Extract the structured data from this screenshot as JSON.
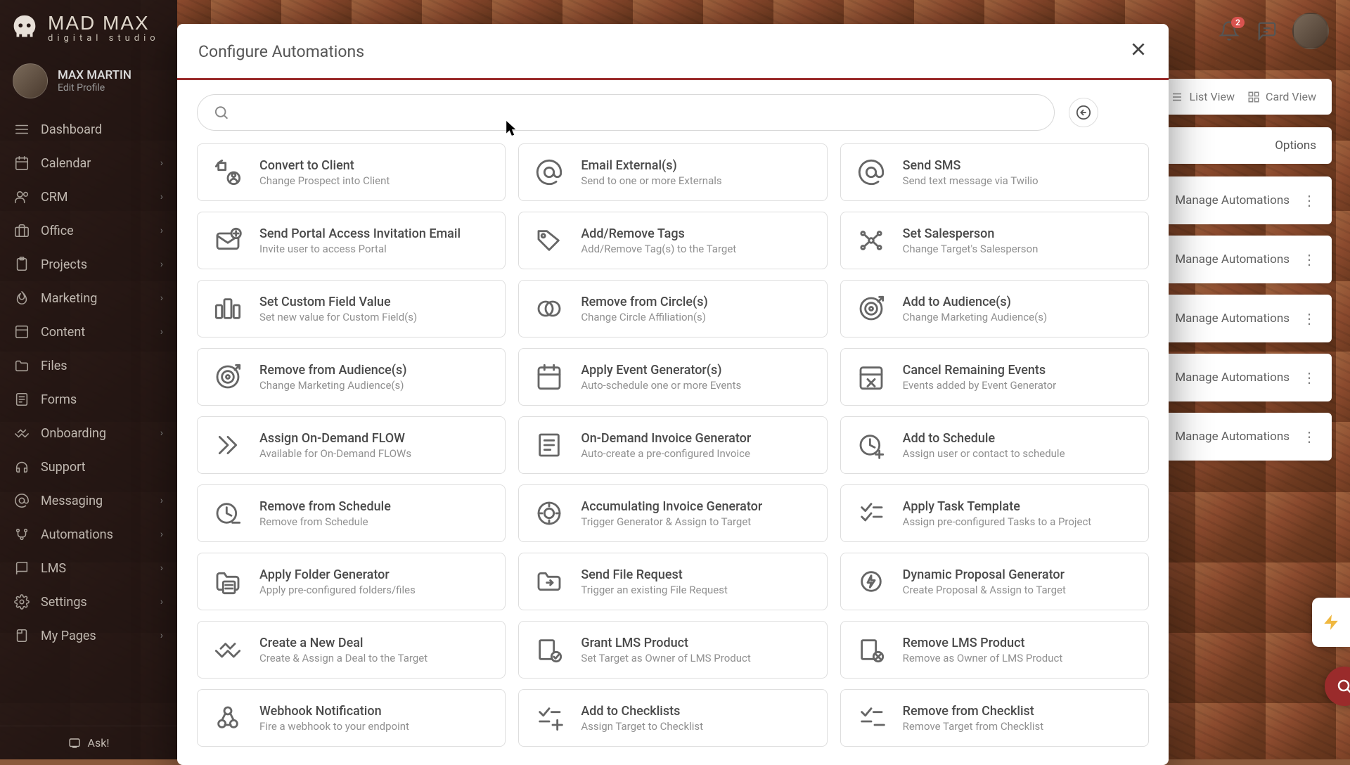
{
  "brand": {
    "name": "MAD MAX",
    "sub": "digital studio"
  },
  "profile": {
    "name": "MAX MARTIN",
    "edit": "Edit Profile"
  },
  "nav": [
    {
      "label": "Dashboard",
      "icon": "menu",
      "chev": false
    },
    {
      "label": "Calendar",
      "icon": "calendar",
      "chev": true
    },
    {
      "label": "CRM",
      "icon": "users",
      "chev": true
    },
    {
      "label": "Office",
      "icon": "briefcase",
      "chev": true
    },
    {
      "label": "Projects",
      "icon": "clipboard",
      "chev": true
    },
    {
      "label": "Marketing",
      "icon": "flame",
      "chev": true
    },
    {
      "label": "Content",
      "icon": "box",
      "chev": true
    },
    {
      "label": "Files",
      "icon": "folder",
      "chev": false
    },
    {
      "label": "Forms",
      "icon": "form",
      "chev": false
    },
    {
      "label": "Onboarding",
      "icon": "handshake",
      "chev": true
    },
    {
      "label": "Support",
      "icon": "headset",
      "chev": false
    },
    {
      "label": "Messaging",
      "icon": "at",
      "chev": true
    },
    {
      "label": "Automations",
      "icon": "branch",
      "chev": true
    },
    {
      "label": "LMS",
      "icon": "book",
      "chev": true
    },
    {
      "label": "Settings",
      "icon": "gear",
      "chev": true
    },
    {
      "label": "My Pages",
      "icon": "page",
      "chev": true
    }
  ],
  "ask": "Ask!",
  "topbar": {
    "notif_count": "2"
  },
  "panel": {
    "list_view": "List View",
    "card_view": "Card View",
    "options": "Options",
    "manage": "Manage Automations"
  },
  "modal": {
    "title": "Configure Automations",
    "search_placeholder": "",
    "cards": [
      {
        "title": "Convert to Client",
        "desc": "Change Prospect into Client",
        "icon": "convert"
      },
      {
        "title": "Email External(s)",
        "desc": "Send to one or more Externals",
        "icon": "at"
      },
      {
        "title": "Send SMS",
        "desc": "Send text message via Twilio",
        "icon": "at"
      },
      {
        "title": "Send Portal Access Invitation Email",
        "desc": "Invite user to access Portal",
        "icon": "mailplus"
      },
      {
        "title": "Add/Remove Tags",
        "desc": "Add/Remove Tag(s) to the Target",
        "icon": "tag"
      },
      {
        "title": "Set Salesperson",
        "desc": "Change Target's Salesperson",
        "icon": "network"
      },
      {
        "title": "Set Custom Field Value",
        "desc": "Set new value for Custom Field(s)",
        "icon": "slider"
      },
      {
        "title": "Remove from Circle(s)",
        "desc": "Change Circle Affiliation(s)",
        "icon": "circles"
      },
      {
        "title": "Add to Audience(s)",
        "desc": "Change Marketing Audience(s)",
        "icon": "target"
      },
      {
        "title": "Remove from Audience(s)",
        "desc": "Change Marketing Audience(s)",
        "icon": "target"
      },
      {
        "title": "Apply Event Generator(s)",
        "desc": "Auto-schedule one or more Events",
        "icon": "calendar"
      },
      {
        "title": "Cancel Remaining Events",
        "desc": "Events added by Event Generator",
        "icon": "calendarx"
      },
      {
        "title": "Assign On-Demand FLOW",
        "desc": "Available for On-Demand FLOWs",
        "icon": "chevrons"
      },
      {
        "title": "On-Demand Invoice Generator",
        "desc": "Auto-create a pre-configured Invoice",
        "icon": "invoice"
      },
      {
        "title": "Add to Schedule",
        "desc": "Assign user or contact to schedule",
        "icon": "clockplus"
      },
      {
        "title": "Remove from Schedule",
        "desc": "Remove from Schedule",
        "icon": "clockminus"
      },
      {
        "title": "Accumulating Invoice Generator",
        "desc": "Trigger Generator & Assign to Target",
        "icon": "geargen"
      },
      {
        "title": "Apply Task Template",
        "desc": "Assign pre-configured Tasks to a Project",
        "icon": "checklist"
      },
      {
        "title": "Apply Folder Generator",
        "desc": "Apply pre-configured folders/files",
        "icon": "foldergen"
      },
      {
        "title": "Send File Request",
        "desc": "Trigger an existing File Request",
        "icon": "foldersend"
      },
      {
        "title": "Dynamic Proposal Generator",
        "desc": "Create Proposal & Assign to Target",
        "icon": "gearbolt"
      },
      {
        "title": "Create a New Deal",
        "desc": "Create & Assign a Deal to the Target",
        "icon": "handshake"
      },
      {
        "title": "Grant LMS Product",
        "desc": "Set Target as Owner of LMS Product",
        "icon": "lmsgrant"
      },
      {
        "title": "Remove LMS Product",
        "desc": "Remove as Owner of LMS Product",
        "icon": "lmsremove"
      },
      {
        "title": "Webhook Notification",
        "desc": "Fire a webhook to your endpoint",
        "icon": "webhook"
      },
      {
        "title": "Add to Checklists",
        "desc": "Assign Target to Checklist",
        "icon": "checklistplus"
      },
      {
        "title": "Remove from Checklist",
        "desc": "Remove Target from Checklist",
        "icon": "checklistminus"
      }
    ]
  }
}
